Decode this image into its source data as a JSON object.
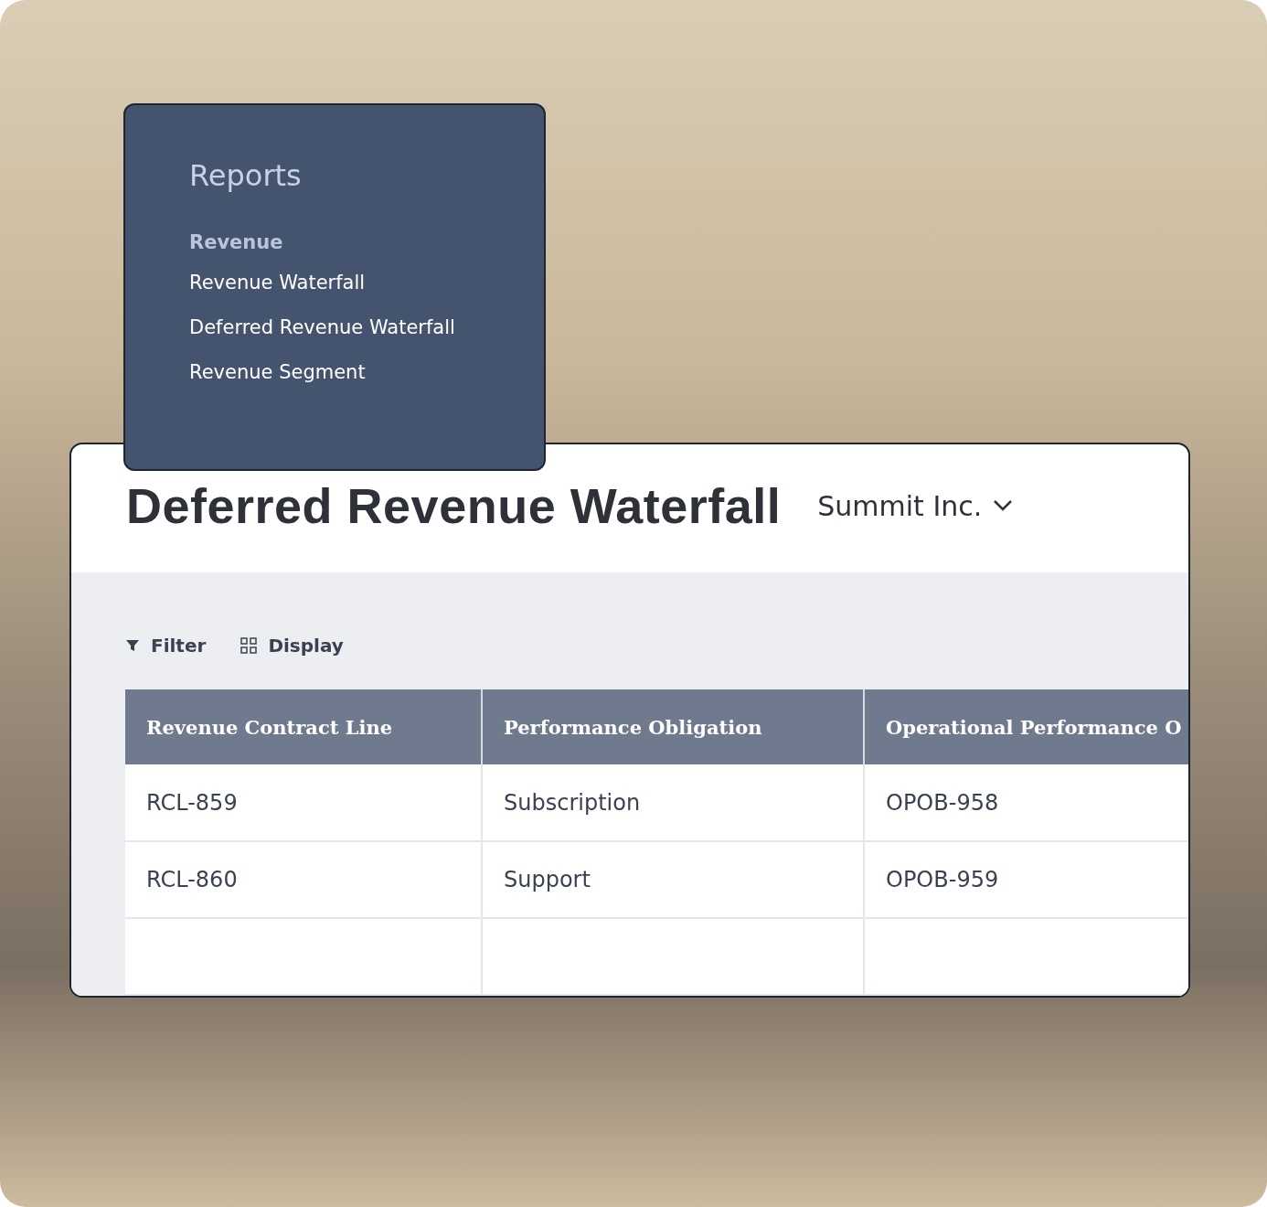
{
  "menu": {
    "title": "Reports",
    "section": "Revenue",
    "items": [
      "Revenue Waterfall",
      "Deferred Revenue Waterfall",
      "Revenue Segment"
    ]
  },
  "page": {
    "title": "Deferred Revenue Waterfall",
    "company": "Summit Inc."
  },
  "toolbar": [
    {
      "label": "Filter",
      "kind": "filter"
    },
    {
      "label": "Display",
      "kind": "display"
    }
  ],
  "table": {
    "columns": [
      "Revenue Contract Line",
      "Performance Obligation",
      "Operational Performance O"
    ],
    "rows": [
      [
        "RCL-859",
        "Subscription",
        "OPOB-958"
      ],
      [
        "RCL-860",
        "Support",
        "OPOB-959"
      ]
    ]
  }
}
